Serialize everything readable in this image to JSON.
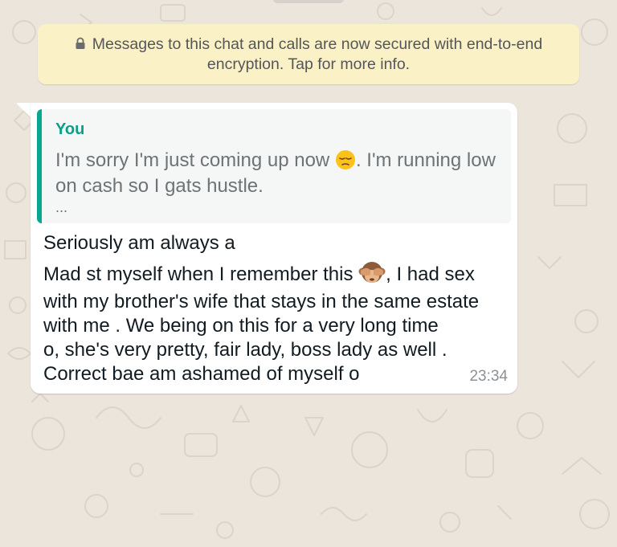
{
  "system_notice": {
    "text": "Messages to this chat and calls are now secured with end-to-end encryption. Tap for more info.",
    "icon": "lock-icon"
  },
  "message": {
    "quoted": {
      "author": "You",
      "text_before_emoji": "I'm sorry I'm just coming up now ",
      "emoji": "pensive-face-icon",
      "text_after_emoji": ". I'm running low on cash so I gats hustle.",
      "ellipsis": "..."
    },
    "lines": [
      "Seriously  am always a",
      "Mad st myself when I remember this",
      ", I had sex",
      "with my brother's wife that stays in the same estate",
      "with me .  We being on this for a very long time",
      "o, she's very pretty,  fair lady, boss lady as well .",
      "Correct bae am ashamed of myself o"
    ],
    "inline_emoji": "see-no-evil-monkey-icon",
    "time": "23:34"
  },
  "colors": {
    "wallpaper": "#ece5dc",
    "notice_bg": "#fbf1c7",
    "quote_bar": "#06a891",
    "quote_author": "#0a9f87",
    "bubble": "#ffffff"
  }
}
